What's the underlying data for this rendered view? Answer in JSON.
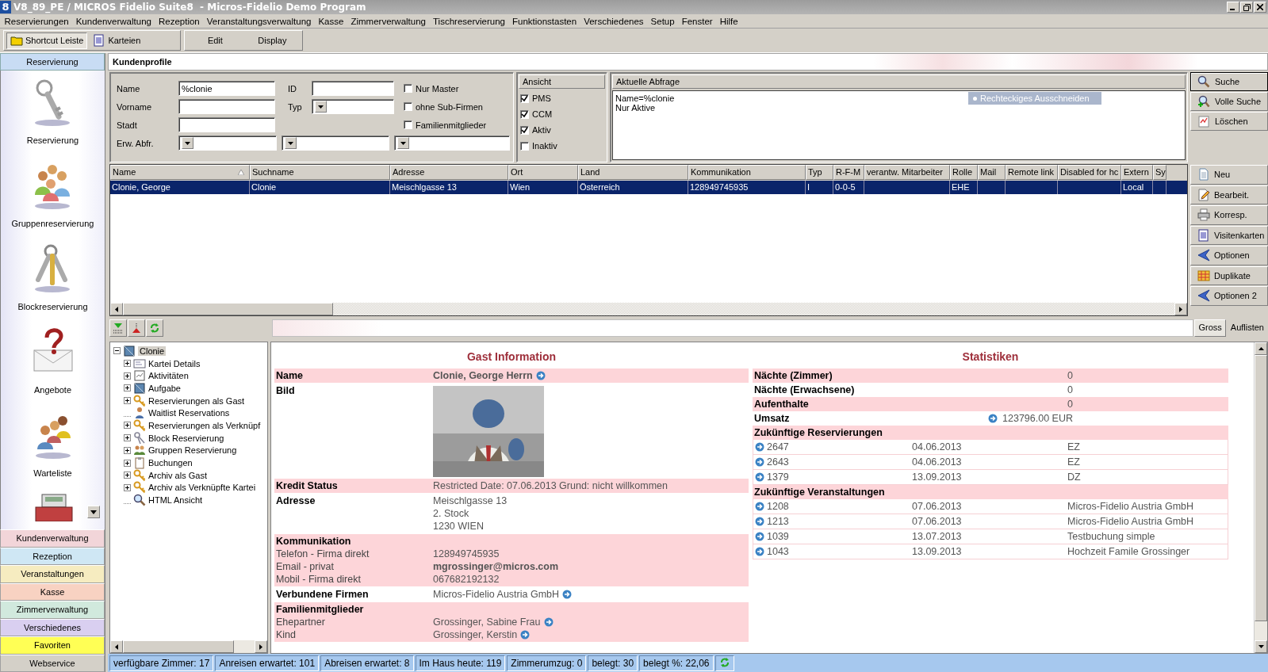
{
  "window": {
    "logo": "8",
    "title": "V8_89_PE / MICROS Fidelio Suite8  - Micros-Fidelio Demo Program"
  },
  "menu": [
    "Reservierungen",
    "Kundenverwaltung",
    "Rezeption",
    "Veranstaltungsverwaltung",
    "Kasse",
    "Zimmerverwaltung",
    "Tischreservierung",
    "Funktionstasten",
    "Verschiedenes",
    "Setup",
    "Fenster",
    "Hilfe"
  ],
  "toolbar": {
    "tabs": [
      {
        "label": "Shortcut Leiste",
        "kind": "folder",
        "selected": true
      },
      {
        "label": "Karteien",
        "kind": "cards",
        "selected": false
      }
    ],
    "buttons": [
      "Edit",
      "Display"
    ]
  },
  "sidebar": {
    "header": "Reservierung",
    "shortcuts": [
      {
        "label": "Reservierung",
        "kind": "key"
      },
      {
        "label": "Gruppenreservierung",
        "kind": "group"
      },
      {
        "label": "Blockreservierung",
        "kind": "keys"
      },
      {
        "label": "Angebote",
        "kind": "letter"
      },
      {
        "label": "Warteliste",
        "kind": "queue"
      },
      {
        "kind": "register"
      }
    ],
    "sections": [
      {
        "label": "Kundenverwaltung",
        "color": "#f2d5d9"
      },
      {
        "label": "Rezeption",
        "color": "#cfe7f4"
      },
      {
        "label": "Veranstaltungen",
        "color": "#f6ecc0"
      },
      {
        "label": "Kasse",
        "color": "#f8d2c2"
      },
      {
        "label": "Zimmerverwaltung",
        "color": "#d1e9dd"
      },
      {
        "label": "Verschiedenes",
        "color": "#d9cff0"
      },
      {
        "label": "Favoriten",
        "color": "#ffff55"
      },
      {
        "label": "Webservice",
        "color": "#d4d0c8"
      }
    ]
  },
  "panel_title": "Kundenprofile",
  "search": {
    "name": {
      "label": "Name",
      "value": "%clonie"
    },
    "id": {
      "label": "ID"
    },
    "vorname": {
      "label": "Vorname"
    },
    "typ": {
      "label": "Typ"
    },
    "stadt": {
      "label": "Stadt"
    },
    "erw": {
      "label": "Erw. Abfr."
    },
    "options": [
      {
        "label": "Nur Master",
        "checked": false
      },
      {
        "label": "ohne Sub-Firmen",
        "checked": false
      },
      {
        "label": "Familienmitglieder",
        "checked": false
      }
    ]
  },
  "ansicht": {
    "title": "Ansicht",
    "options": [
      {
        "label": "PMS",
        "checked": true
      },
      {
        "label": "CCM",
        "checked": true
      },
      {
        "label": "Aktiv",
        "checked": true
      },
      {
        "label": "Inaktiv",
        "checked": false
      }
    ]
  },
  "query": {
    "title": "Aktuelle Abfrage",
    "lines": [
      "Name=%clonie",
      "Nur Aktive"
    ]
  },
  "tooltip": "Rechteckiges Ausschneiden",
  "search_buttons": [
    {
      "label": "Suche",
      "kind": "search"
    },
    {
      "label": "Volle Suche",
      "kind": "fullsearch"
    },
    {
      "label": "Löschen",
      "kind": "erase"
    }
  ],
  "table": {
    "columns": [
      {
        "label": "Name",
        "sorted": true
      },
      {
        "label": "Suchname",
        "sorted": false
      },
      {
        "label": "Adresse",
        "sorted": false
      },
      {
        "label": "Ort",
        "sorted": false
      },
      {
        "label": "Land",
        "sorted": false
      },
      {
        "label": "Kommunikation",
        "sorted": false
      },
      {
        "label": "Typ",
        "sorted": false
      },
      {
        "label": "R-F-M",
        "sorted": false
      },
      {
        "label": "verantw. Mitarbeiter",
        "sorted": false
      },
      {
        "label": "Rolle",
        "sorted": false
      },
      {
        "label": "Mail",
        "sorted": false
      },
      {
        "label": "Remote link",
        "sorted": false
      },
      {
        "label": "Disabled for hc",
        "sorted": false
      },
      {
        "label": "Extern",
        "sorted": false
      },
      {
        "label": "Sy",
        "sorted": false
      }
    ],
    "rows": [
      {
        "selected": true,
        "cells": [
          "Clonie, George",
          "Clonie",
          "Meischlgasse 13",
          "Wien",
          "Österreich",
          "128949745935",
          "I",
          "0-0-5",
          "",
          "EHE",
          "",
          "",
          "",
          "Local",
          ""
        ]
      }
    ]
  },
  "record_buttons": [
    {
      "label": "Neu",
      "kind": "new"
    },
    {
      "label": "Bearbeit.",
      "kind": "edit"
    },
    {
      "label": "Korresp.",
      "kind": "print"
    },
    {
      "label": "Visitenkarten",
      "kind": "cards"
    },
    {
      "label": "Optionen",
      "kind": "options"
    },
    {
      "label": "Duplikate",
      "kind": "duplicates"
    },
    {
      "label": "Optionen 2",
      "kind": "options"
    }
  ],
  "view_tabs": [
    {
      "label": "Gross",
      "selected": true
    },
    {
      "label": "Auflisten",
      "selected": false
    }
  ],
  "tree": {
    "label": "Clonie",
    "expanded": true,
    "selected": true,
    "children": [
      {
        "label": "Kartei Details",
        "kind": "card",
        "expandable": true
      },
      {
        "label": "Aktivitäten",
        "kind": "activity",
        "expandable": true
      },
      {
        "label": "Aufgabe",
        "kind": "task",
        "expandable": true
      },
      {
        "label": "Reservierungen als Gast",
        "kind": "key",
        "expandable": true
      },
      {
        "label": "Waitlist Reservations",
        "kind": "waitlist",
        "expandable": false
      },
      {
        "label": "Reservierungen als Verknüpf",
        "kind": "key",
        "expandable": true
      },
      {
        "label": "Block Reservierung",
        "kind": "block",
        "expandable": true
      },
      {
        "label": "Gruppen Reservierung",
        "kind": "group",
        "expandable": true
      },
      {
        "label": "Buchungen",
        "kind": "clipboard",
        "expandable": true
      },
      {
        "label": "Archiv als Gast",
        "kind": "key",
        "expandable": true
      },
      {
        "label": "Archiv als Verknüpfte Kartei",
        "kind": "key",
        "expandable": true
      },
      {
        "label": "HTML Ansicht",
        "kind": "search",
        "expandable": false
      }
    ]
  },
  "guest": {
    "title": "Gast Information",
    "rows": [
      {
        "kind": "field",
        "label": "Name",
        "values": [
          "Clonie, George Herrn"
        ],
        "bold": true,
        "link": true
      },
      {
        "kind": "picture",
        "label": "Bild"
      },
      {
        "kind": "field",
        "label": "Kredit Status",
        "values": [
          "Restricted Date: 07.06.2013 Grund: nicht willkommen"
        ],
        "bold": false,
        "link": false
      },
      {
        "kind": "field",
        "label": "Adresse",
        "values": [
          "Meischlgasse 13",
          "2. Stock",
          "1230 WIEN"
        ],
        "bold": false,
        "link": false
      },
      {
        "kind": "group",
        "label": "Kommunikation",
        "items": [
          {
            "label": "Telefon - Firma direkt",
            "value": "128949745935",
            "bold": false,
            "link": false
          },
          {
            "label": "Email - privat",
            "value": "mgrossinger@micros.com",
            "bold": true,
            "link": false
          },
          {
            "label": "Mobil - Firma direkt",
            "value": "067682192132",
            "bold": false,
            "link": false
          }
        ]
      },
      {
        "kind": "field",
        "label": "Verbundene Firmen",
        "values": [
          "Micros-Fidelio Austria GmbH"
        ],
        "bold": false,
        "link": true
      },
      {
        "kind": "group",
        "label": "Familienmitglieder",
        "items": [
          {
            "label": "Ehepartner",
            "value": "Grossinger, Sabine Frau",
            "bold": false,
            "link": true
          },
          {
            "label": "Kind",
            "value": "Grossinger, Kerstin",
            "bold": false,
            "link": true
          }
        ]
      }
    ]
  },
  "stats": {
    "title": "Statistiken",
    "rows": [
      {
        "label": "Nächte (Zimmer)",
        "value": "0",
        "link": false
      },
      {
        "label": "Nächte (Erwachsene)",
        "value": "0",
        "link": false
      },
      {
        "label": "Aufenthalte",
        "value": "0",
        "link": false
      },
      {
        "label": "Umsatz",
        "value": "123796.00 EUR",
        "link": true
      }
    ],
    "sections": [
      {
        "title": "Zukünftige Reservierungen",
        "entries": [
          {
            "number": "2647",
            "date": "04.06.2013",
            "info": "EZ"
          },
          {
            "number": "2643",
            "date": "04.06.2013",
            "info": "EZ"
          },
          {
            "number": "1379",
            "date": "13.09.2013",
            "info": "DZ"
          }
        ]
      },
      {
        "title": "Zukünftige Veranstaltungen",
        "entries": [
          {
            "number": "1208",
            "date": "07.06.2013",
            "info": "Micros-Fidelio Austria GmbH"
          },
          {
            "number": "1213",
            "date": "07.06.2013",
            "info": "Micros-Fidelio Austria GmbH"
          },
          {
            "number": "1039",
            "date": "13.07.2013",
            "info": "Testbuchung simple"
          },
          {
            "number": "1043",
            "date": "13.09.2013",
            "info": "Hochzeit Famile Grossinger"
          }
        ]
      }
    ]
  },
  "status_bar": [
    "verfügbare Zimmer: 17",
    "Anreisen erwartet: 101",
    "Abreisen erwartet: 8",
    "Im Haus heute: 119",
    "Zimmerumzug: 0",
    "belegt: 30",
    "belegt %: 22,06"
  ]
}
